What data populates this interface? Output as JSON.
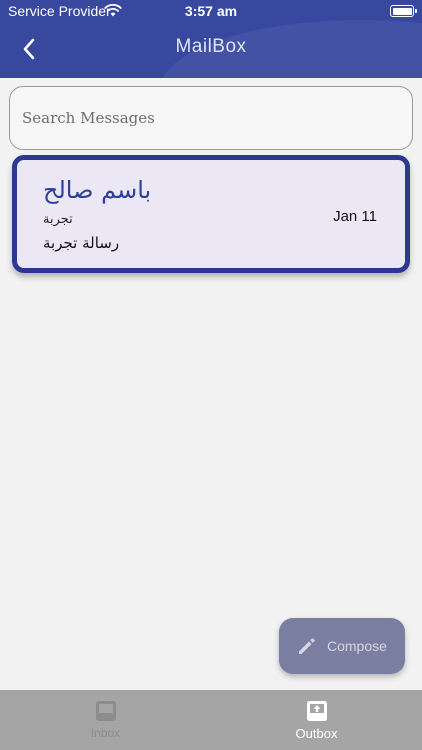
{
  "status_bar": {
    "carrier": "Service Provider",
    "time": "3:57 am"
  },
  "header": {
    "title": "MailBox",
    "color": "#2e3f9a"
  },
  "search": {
    "placeholder": "Search Messages"
  },
  "messages": [
    {
      "sender": "باسم صالح",
      "subject": "تجربة",
      "preview": "رسالة تجربة",
      "date": "Jan 11"
    }
  ],
  "compose": {
    "label": "Compose",
    "icon": "pencil-icon"
  },
  "tabs": [
    {
      "label": "Inbox",
      "icon": "inbox-icon",
      "active": false
    },
    {
      "label": "Outbox",
      "icon": "outbox-icon",
      "active": true
    }
  ]
}
